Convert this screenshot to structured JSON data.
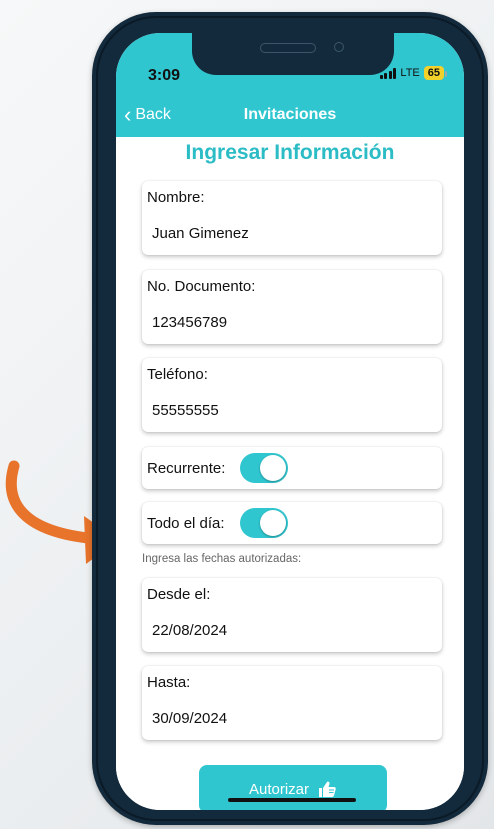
{
  "status_bar": {
    "time": "3:09",
    "network": "LTE",
    "battery": "65"
  },
  "nav": {
    "back_label": "Back",
    "title": "Invitaciones"
  },
  "form": {
    "title": "Ingresar Información",
    "fields": [
      {
        "label": "Nombre:",
        "value": "Juan Gimenez"
      },
      {
        "label": "No. Documento:",
        "value": "123456789"
      },
      {
        "label": "Teléfono:",
        "value": "55555555"
      }
    ],
    "toggles": [
      {
        "label": "Recurrente:",
        "on": true
      },
      {
        "label": "Todo el día:",
        "on": true
      }
    ],
    "dates_hint": "Ingresa las fechas autorizadas:",
    "dates": [
      {
        "label": "Desde el:",
        "value": "22/08/2024"
      },
      {
        "label": "Hasta:",
        "value": "30/09/2024"
      }
    ],
    "submit_label": "Autorizar",
    "submit_icon": "thumbs-up-icon"
  },
  "colors": {
    "accent": "#30c6cf",
    "title": "#2bbcc6",
    "phone_frame": "#132a3c",
    "arrow": "#e8732a"
  }
}
